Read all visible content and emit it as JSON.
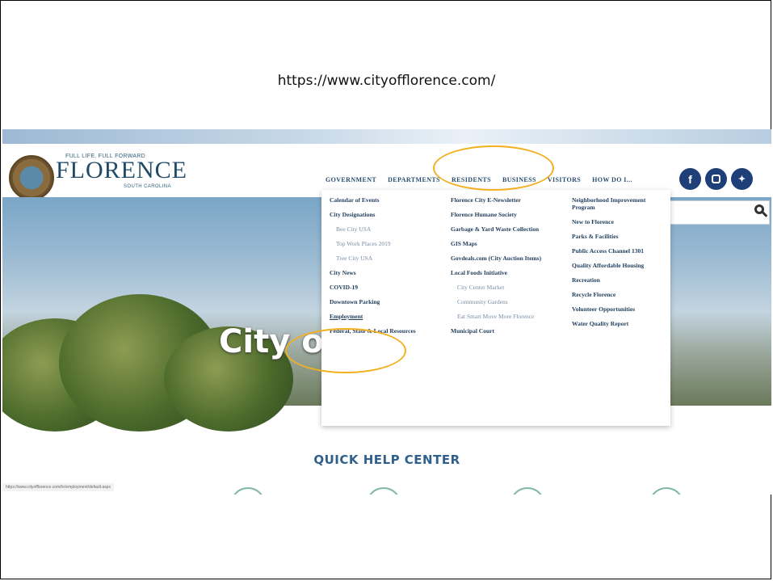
{
  "caption": {
    "url": "https://www.cityofflorence.com/"
  },
  "site": {
    "logo_tagline": "FULL LIFE. FULL FORWARD",
    "logo_word": "FLORENCE",
    "logo_sub": "SOUTH CAROLINA",
    "nav": [
      "GOVERNMENT",
      "DEPARTMENTS",
      "RESIDENTS",
      "BUSINESS",
      "VISITORS",
      "HOW DO I..."
    ],
    "social_icons": [
      "facebook-icon",
      "instagram-icon",
      "twitter-icon"
    ],
    "hero_title": "City o",
    "quick_help": "QUICK HELP CENTER",
    "status_url": "https://www.cityofflorence.com/hr/employment/default.aspx"
  },
  "menu": {
    "col1": [
      {
        "label": "Calendar of Events",
        "sub": false
      },
      {
        "label": "City Designations",
        "sub": false
      },
      {
        "label": "Bee City USA",
        "sub": true
      },
      {
        "label": "Top Work Places 2019",
        "sub": true
      },
      {
        "label": "Tree City USA",
        "sub": true
      },
      {
        "label": "City News",
        "sub": false
      },
      {
        "label": "COVID-19",
        "sub": false
      },
      {
        "label": "Downtown Parking",
        "sub": false
      },
      {
        "label": "Employment",
        "sub": false
      },
      {
        "label": "Federal, State & Local Resources",
        "sub": false
      }
    ],
    "col2": [
      {
        "label": "Florence City E-Newsletter",
        "sub": false
      },
      {
        "label": "Florence Humane Society",
        "sub": false
      },
      {
        "label": "Garbage & Yard Waste Collection",
        "sub": false
      },
      {
        "label": "GIS Maps",
        "sub": false
      },
      {
        "label": "Govdeals.com (City Auction Items)",
        "sub": false
      },
      {
        "label": "Local Foods Initiative",
        "sub": false
      },
      {
        "label": "City Center Market",
        "sub": true
      },
      {
        "label": "Community Gardens",
        "sub": true
      },
      {
        "label": "Eat Smart Move More Florence",
        "sub": true
      },
      {
        "label": "Municipal Court",
        "sub": false
      }
    ],
    "col3": [
      {
        "label": "Neighborhood Improvement Program",
        "sub": false
      },
      {
        "label": "New to Florence",
        "sub": false
      },
      {
        "label": "Parks & Facilities",
        "sub": false
      },
      {
        "label": "Public Access Channel 1301",
        "sub": false
      },
      {
        "label": "Quality Affordable Housing",
        "sub": false
      },
      {
        "label": "Recreation",
        "sub": false
      },
      {
        "label": "Recycle Florence",
        "sub": false
      },
      {
        "label": "Volunteer Opportunities",
        "sub": false
      },
      {
        "label": "Water Quality Report",
        "sub": false
      }
    ]
  },
  "colors": {
    "highlight": "#f2b01e",
    "brand": "#1f4a68",
    "social": "#1f3f78"
  }
}
